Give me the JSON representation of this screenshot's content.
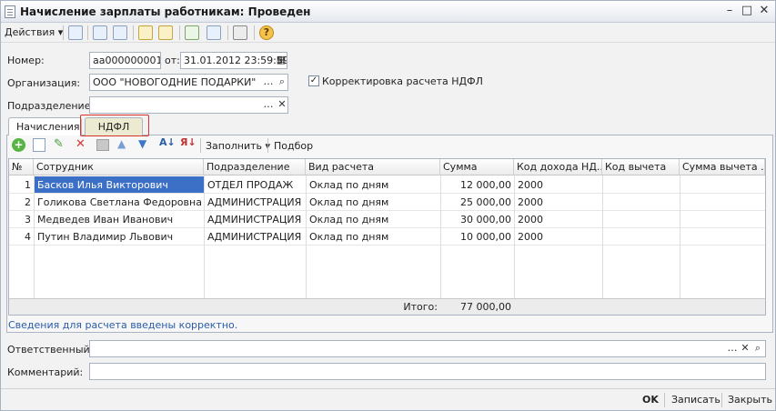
{
  "window": {
    "title": "Начисление зарплаты работникам: Проведен",
    "minimize": "–",
    "restore": "□",
    "close": "✕"
  },
  "toolbar": {
    "actions_label": "Действия",
    "actions_arrow": "▾",
    "help": "?"
  },
  "header": {
    "number_label": "Номер:",
    "number_value": "aa000000001",
    "date_label": "от:",
    "date_value": "31.01.2012 23:59:59",
    "org_label": "Организация:",
    "org_value": "ООО \"НОВОГОДНИЕ ПОДАРКИ\"",
    "ndfl_check_label": "Корректировка расчета НДФЛ",
    "ndfl_checked": "✓",
    "dept_label": "Подразделение:",
    "dept_value": ""
  },
  "tabs": [
    {
      "label": "Начисления"
    },
    {
      "label": "НДФЛ"
    }
  ],
  "subtoolbar": {
    "fill_label": "Заполнить",
    "fill_arrow": "▾",
    "select_label": "Подбор"
  },
  "table": {
    "columns": [
      "№",
      "Сотрудник",
      "Подразделение",
      "Вид расчета",
      "Сумма",
      "Код дохода НД...",
      "Код вычета",
      "Сумма вычета ..."
    ],
    "rows": [
      {
        "n": "1",
        "employee": "Басков Илья Викторович",
        "dept": "ОТДЕЛ ПРОДАЖ",
        "calc": "Оклад по дням",
        "sum": "12 000,00",
        "income_code": "2000",
        "deduct_code": "",
        "deduct_sum": ""
      },
      {
        "n": "2",
        "employee": "Голикова Светлана Федоровна",
        "dept": "АДМИНИСТРАЦИЯ",
        "calc": "Оклад по дням",
        "sum": "25 000,00",
        "income_code": "2000",
        "deduct_code": "",
        "deduct_sum": ""
      },
      {
        "n": "3",
        "employee": "Медведев Иван Иванович",
        "dept": "АДМИНИСТРАЦИЯ",
        "calc": "Оклад по дням",
        "sum": "30 000,00",
        "income_code": "2000",
        "deduct_code": "",
        "deduct_sum": ""
      },
      {
        "n": "4",
        "employee": "Путин Владимир Львович",
        "dept": "АДМИНИСТРАЦИЯ",
        "calc": "Оклад по дням",
        "sum": "10 000,00",
        "income_code": "2000",
        "deduct_code": "",
        "deduct_sum": ""
      }
    ],
    "total_label": "Итого:",
    "total_value": "77 000,00"
  },
  "status_message": "Сведения для расчета введены корректно.",
  "footer": {
    "responsible_label": "Ответственный:",
    "responsible_value": "",
    "comment_label": "Комментарий:",
    "comment_value": ""
  },
  "bottom": {
    "ok": "OK",
    "save": "Записать",
    "close": "Закрыть"
  },
  "colors": {
    "selection": "#3c6fc6",
    "highlight_border": "#d9342b",
    "status_text": "#2a5ca8"
  }
}
